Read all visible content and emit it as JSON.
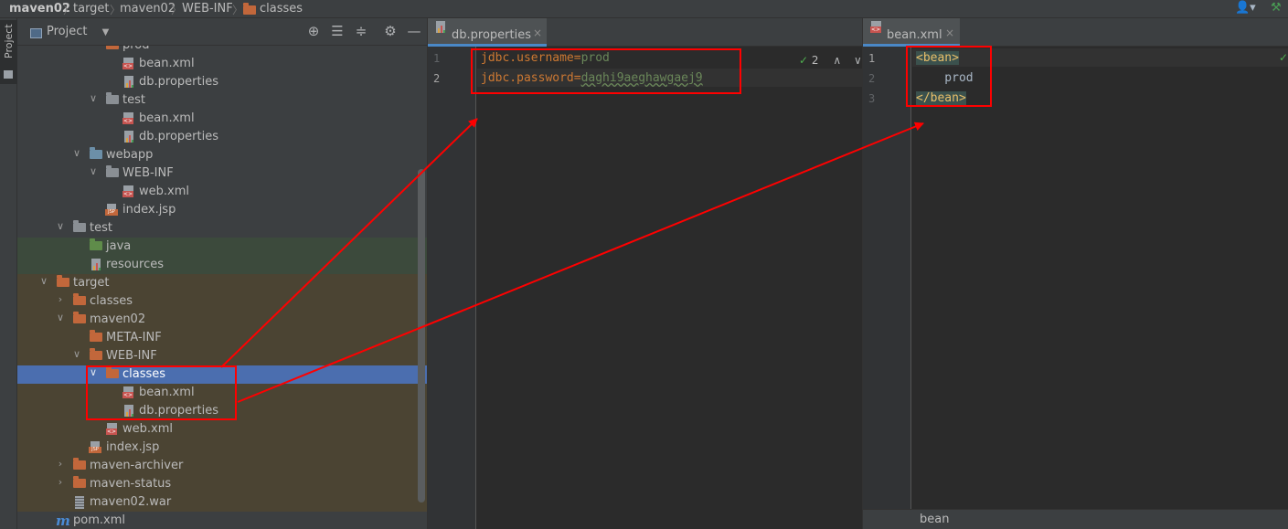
{
  "breadcrumb": {
    "items": [
      "maven02",
      "target",
      "maven02",
      "WEB-INF",
      "classes"
    ]
  },
  "tool_strip": {
    "project_tab_label": "Project"
  },
  "project_panel": {
    "title": "Project",
    "tree": [
      {
        "label": "prod",
        "icon": "folder-icon"
      },
      {
        "label": "bean.xml",
        "icon": "xml-file-icon"
      },
      {
        "label": "db.properties",
        "icon": "properties-file-icon"
      },
      {
        "label": "test",
        "icon": "folder-icon"
      },
      {
        "label": "bean.xml",
        "icon": "xml-file-icon"
      },
      {
        "label": "db.properties",
        "icon": "properties-file-icon"
      },
      {
        "label": "webapp",
        "icon": "web-folder-icon"
      },
      {
        "label": "WEB-INF",
        "icon": "folder-icon"
      },
      {
        "label": "web.xml",
        "icon": "xml-file-icon"
      },
      {
        "label": "index.jsp",
        "icon": "jsp-file-icon"
      },
      {
        "label": "test",
        "icon": "folder-icon"
      },
      {
        "label": "java",
        "icon": "source-folder-icon"
      },
      {
        "label": "resources",
        "icon": "resources-folder-icon"
      },
      {
        "label": "target",
        "icon": "folder-icon"
      },
      {
        "label": "classes",
        "icon": "folder-icon"
      },
      {
        "label": "maven02",
        "icon": "folder-icon"
      },
      {
        "label": "META-INF",
        "icon": "folder-icon"
      },
      {
        "label": "WEB-INF",
        "icon": "folder-icon"
      },
      {
        "label": "classes",
        "icon": "folder-icon",
        "selected": true
      },
      {
        "label": "bean.xml",
        "icon": "xml-file-icon"
      },
      {
        "label": "db.properties",
        "icon": "properties-file-icon"
      },
      {
        "label": "web.xml",
        "icon": "xml-file-icon"
      },
      {
        "label": "index.jsp",
        "icon": "jsp-file-icon"
      },
      {
        "label": "maven-archiver",
        "icon": "folder-icon"
      },
      {
        "label": "maven-status",
        "icon": "folder-icon"
      },
      {
        "label": "maven02.war",
        "icon": "war-file-icon"
      },
      {
        "label": "pom.xml",
        "icon": "maven-icon"
      }
    ]
  },
  "editor_left": {
    "tab_label": "db.properties",
    "line_numbers": [
      "1",
      "2"
    ],
    "lines": [
      {
        "key": "jdbc.username",
        "eq": "=",
        "value": "prod"
      },
      {
        "key": "jdbc.password",
        "eq": "=",
        "value": "daghi9aeghawgaej9"
      }
    ],
    "inspection_count": "2"
  },
  "editor_right": {
    "tab_label": "bean.xml",
    "line_numbers": [
      "1",
      "2",
      "3"
    ],
    "lines": [
      "<bean>",
      "    prod",
      "</bean>"
    ],
    "breadcrumb": "bean"
  },
  "colors": {
    "annotation_red": "#ff0000",
    "selection_blue": "#4b6eaf",
    "folder_orange": "#c2673b"
  }
}
